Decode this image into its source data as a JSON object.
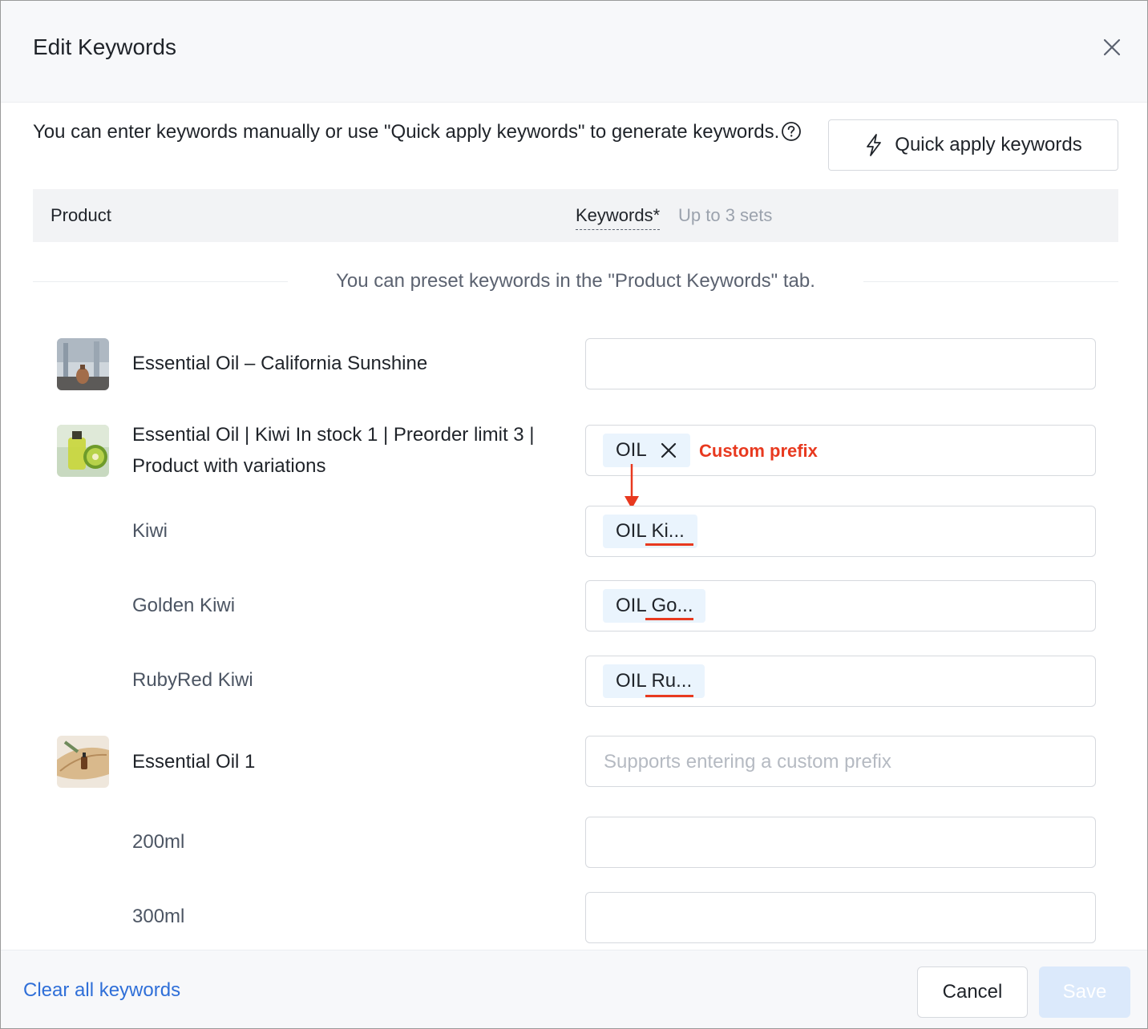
{
  "dialog": {
    "title": "Edit Keywords",
    "intro_text": "You can enter keywords manually or use \"Quick apply keywords\" to generate keywords.",
    "quick_apply_label": "Quick apply keywords"
  },
  "table": {
    "col_product": "Product",
    "col_keywords": "Keywords*",
    "col_keywords_hint": "Up to 3 sets",
    "preset_note": "You can preset keywords in the \"Product Keywords\" tab."
  },
  "rows": [
    {
      "name": "Essential Oil – California Sunshine",
      "image": "product-diffuser"
    },
    {
      "name": "Essential Oil | Kiwi In stock 1 | Preorder limit 3 | Product with variations",
      "image": "product-kiwi-oil",
      "tag": "OIL"
    },
    {
      "variant": "Kiwi",
      "tag": "OIL Ki..."
    },
    {
      "variant": "Golden Kiwi",
      "tag": "OIL Go..."
    },
    {
      "variant": "RubyRed Kiwi",
      "tag": "OIL Ru..."
    },
    {
      "name": "Essential Oil 1",
      "image": "product-oil-leaf",
      "placeholder": "Supports entering a custom prefix"
    },
    {
      "variant": "200ml"
    },
    {
      "variant": "300ml"
    }
  ],
  "annotation": {
    "label": "Custom prefix",
    "color": "#e8391f"
  },
  "footer": {
    "clear_label": "Clear all keywords",
    "cancel_label": "Cancel",
    "save_label": "Save"
  },
  "colors": {
    "accent": "#2f6fd8",
    "tag_bg": "#eaf4fd",
    "annotation": "#e8391f"
  }
}
